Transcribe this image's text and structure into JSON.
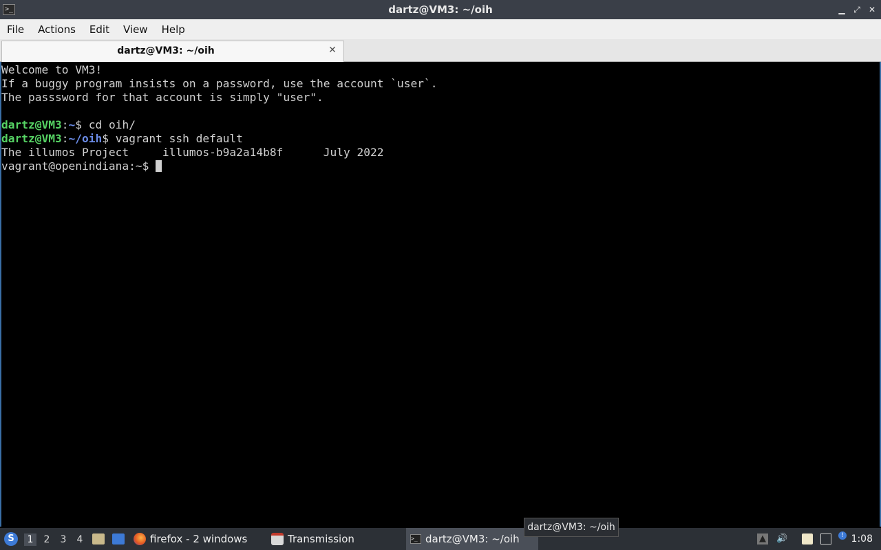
{
  "window": {
    "title": "dartz@VM3: ~/oih",
    "app_icon": "terminal-icon",
    "minimize": "▁",
    "restore": "⤢",
    "close": "✕"
  },
  "menu": [
    "File",
    "Actions",
    "Edit",
    "View",
    "Help"
  ],
  "tab": {
    "label": "dartz@VM3: ~/oih",
    "close": "✕"
  },
  "terminal": {
    "lines": [
      {
        "type": "text",
        "text": "Welcome to VM3!"
      },
      {
        "type": "text",
        "text": "If a buggy program insists on a password, use the account `user`."
      },
      {
        "type": "text",
        "text": "The passsword for that account is simply \"user\"."
      },
      {
        "type": "text",
        "text": ""
      },
      {
        "type": "prompt",
        "user": "dartz@VM3",
        "sep": ":",
        "path": "~",
        "symbol": "$",
        "cmd": " cd oih/"
      },
      {
        "type": "prompt",
        "user": "dartz@VM3",
        "sep": ":",
        "path": "~/oih",
        "symbol": "$",
        "cmd": " vagrant ssh default"
      },
      {
        "type": "text",
        "text": "The illumos Project     illumos-b9a2a14b8f      July 2022"
      },
      {
        "type": "text",
        "text": "vagrant@openindiana:~$ ",
        "cursor": true
      }
    ]
  },
  "taskbar": {
    "desktops": [
      "1",
      "2",
      "3",
      "4"
    ],
    "active_desktop": "1",
    "tasks": [
      {
        "label": "firefox - 2 windows",
        "icon": "firefox-icon"
      },
      {
        "label": "Transmission",
        "icon": "transmission-icon"
      },
      {
        "label": "dartz@VM3: ~/oih",
        "icon": "terminal-icon"
      }
    ],
    "tooltip": "dartz@VM3: ~/oih",
    "clock": "1:08"
  },
  "colors": {
    "prompt_user": "#56d364",
    "prompt_path": "#6b8ce8",
    "terminal_fg": "#d0d0d0",
    "taskbar_bg": "#2c3036"
  }
}
